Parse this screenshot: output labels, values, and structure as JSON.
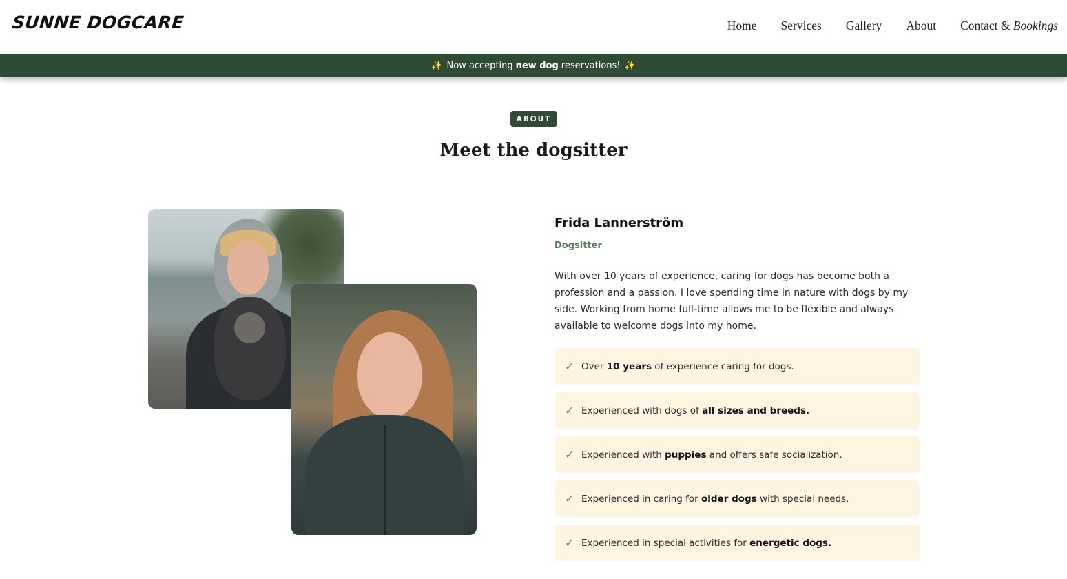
{
  "header": {
    "logo": "SUNNE DOGCARE",
    "nav": [
      {
        "label": "Home"
      },
      {
        "label": "Services"
      },
      {
        "label": "Gallery"
      },
      {
        "label": "About"
      },
      {
        "label_plain": "Contact & ",
        "label_italic": "Bookings"
      }
    ]
  },
  "banner": {
    "spark_icon": "✨",
    "before": "Now accepting",
    "bold": "new dog",
    "after": "reservations!"
  },
  "section": {
    "badge": "ABOUT",
    "title": "Meet the dogsitter"
  },
  "profile": {
    "name": "Frida Lannerström",
    "role": "Dogsitter",
    "bio": "With over 10 years of experience, caring for dogs has become both a profession and a passion. I love spending time in nature with dogs by my side. Working from home full-time allows me to be flexible and always available to welcome dogs into my home."
  },
  "features": [
    {
      "before": "Over ",
      "bold": "10 years",
      "after": " of experience caring for dogs."
    },
    {
      "before": "Experienced with dogs of ",
      "bold": "all sizes and breeds.",
      "after": ""
    },
    {
      "before": "Experienced with ",
      "bold": "puppies",
      "after": " and offers safe socialization."
    },
    {
      "before": "Experienced in caring for ",
      "bold": "older dogs",
      "after": " with special needs."
    },
    {
      "before": "Experienced in special activities for ",
      "bold": "energetic dogs.",
      "after": ""
    }
  ],
  "colors": {
    "brand_green": "#2f4a35",
    "feature_bg": "#fdf5e2",
    "role_color": "#5b7a5f"
  }
}
